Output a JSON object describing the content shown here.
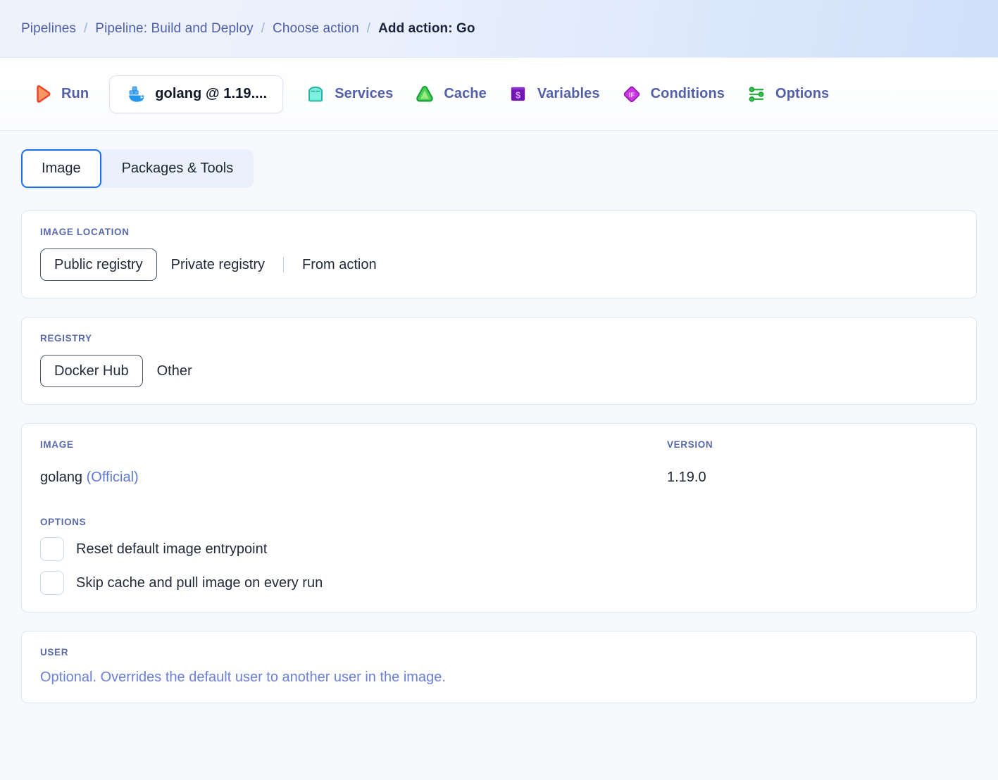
{
  "breadcrumb": {
    "separator": "/",
    "items": [
      {
        "label": "Pipelines",
        "current": false
      },
      {
        "label": "Pipeline: Build and Deploy",
        "current": false
      },
      {
        "label": "Choose action",
        "current": false
      },
      {
        "label": "Add action: Go",
        "current": true
      }
    ]
  },
  "toolbar": {
    "items": [
      {
        "label": "Run",
        "icon": "play-icon"
      },
      {
        "label": "golang @ 1.19....",
        "icon": "docker-whale-icon"
      },
      {
        "label": "Services",
        "icon": "services-box-icon"
      },
      {
        "label": "Cache",
        "icon": "cache-triangle-icon"
      },
      {
        "label": "Variables",
        "icon": "variables-dollar-icon"
      },
      {
        "label": "Conditions",
        "icon": "conditions-if-diamond-icon"
      },
      {
        "label": "Options",
        "icon": "options-sliders-icon"
      }
    ]
  },
  "tabs": [
    {
      "label": "Image",
      "active": true
    },
    {
      "label": "Packages & Tools",
      "active": false
    }
  ],
  "image_location": {
    "label": "Image location",
    "options": [
      {
        "label": "Public registry",
        "selected": true
      },
      {
        "label": "Private registry",
        "selected": false
      },
      {
        "label": "From action",
        "selected": false
      }
    ],
    "divider_after_index": 1
  },
  "registry": {
    "label": "Registry",
    "options": [
      {
        "label": "Docker Hub",
        "selected": true
      },
      {
        "label": "Other",
        "selected": false
      }
    ]
  },
  "image_section": {
    "image_header": "Image",
    "version_header": "Version",
    "image_name": "golang",
    "image_official_tag": "(Official)",
    "version_value": "1.19.0",
    "options_label": "Options",
    "options": [
      {
        "label": "Reset default image entrypoint",
        "checked": false
      },
      {
        "label": "Skip cache and pull image on every run",
        "checked": false
      }
    ]
  },
  "user_section": {
    "label": "User",
    "hint": "Optional. Overrides the default user to another user in the image."
  },
  "colors": {
    "accent_blue": "#1a6ef0",
    "breadcrumb_link": "#4f5fa8",
    "toolbar_label": "#5360a8",
    "card_border": "#dde6f3",
    "page_bg": "#f7f9fd",
    "hint_text": "#6b80d8",
    "official_tag": "#5f79d6",
    "run_icon": "#f2673a",
    "docker_icon": "#2596ed",
    "services_icon": "#63e6d8",
    "cache_icon": "#37b34a",
    "variables_icon": "#7016b5",
    "conditions_icon": "#c837e0",
    "options_icon": "#2eb34a"
  }
}
